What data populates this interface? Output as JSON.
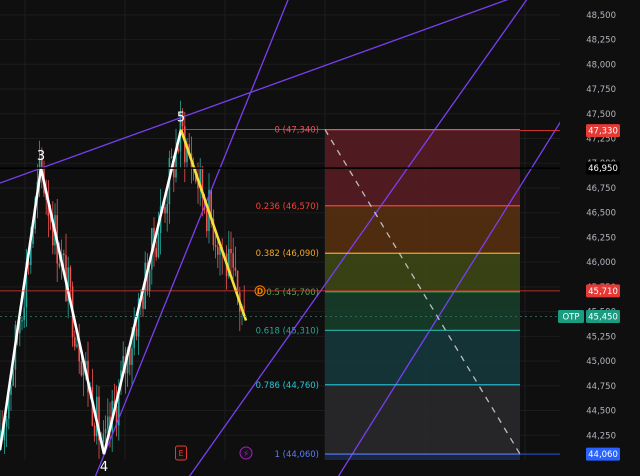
{
  "chart_data": {
    "type": "candlestick",
    "instrument_ticker": "OTP",
    "ylim": [
      44000,
      48650
    ],
    "y_ticks": [
      44250,
      44500,
      44750,
      45000,
      45250,
      45500,
      45750,
      46000,
      46250,
      46500,
      46750,
      47000,
      47250,
      47500,
      47750,
      48000,
      48250,
      48500
    ],
    "y_tick_labels": [
      "44,250",
      "44,500",
      "44,750",
      "45,000",
      "45,250",
      "45,500",
      "45,750",
      "46,000",
      "46,250",
      "46,500",
      "46,750",
      "47,000",
      "47,250",
      "47,500",
      "47,750",
      "48,000",
      "48,250",
      "48,500"
    ],
    "price_tags": [
      {
        "label": "47,330",
        "price": 47330,
        "color": "#e53935",
        "kind": "fib-top"
      },
      {
        "label": "46,950",
        "price": 46950,
        "color": "#000000",
        "kind": "marker"
      },
      {
        "label": "45,710",
        "price": 45710,
        "color": "#e53935",
        "kind": "marker"
      },
      {
        "label": "45,450",
        "price": 45450,
        "color": "#1b9b7f",
        "kind": "last-price"
      },
      {
        "label": "44,060",
        "price": 44060,
        "color": "#2962ff",
        "kind": "fib-bottom"
      }
    ],
    "current_price": 45450,
    "wave_points": [
      {
        "label": "",
        "bar": 0,
        "price": 44100
      },
      {
        "label": "3",
        "bar": 41,
        "price": 46950
      },
      {
        "label": "4",
        "bar": 104,
        "price": 44060
      },
      {
        "label": "5",
        "bar": 181,
        "price": 47340
      }
    ],
    "impulse_leg": {
      "from": {
        "bar": 181,
        "price": 47340
      },
      "to": {
        "bar": 246,
        "price": 45410
      },
      "color": "#f5e13a"
    },
    "fibonacci": {
      "from_bar": 325,
      "to_bar": 520,
      "levels": [
        {
          "ratio": "0",
          "price": 47340,
          "label": "0 (47,340)",
          "color": "#e05660",
          "fill": "#5a1d24"
        },
        {
          "ratio": "0.236",
          "price": 46570,
          "label": "0.236 (46,570)",
          "color": "#f44336",
          "fill": "#5a3010"
        },
        {
          "ratio": "0.382",
          "price": 46090,
          "label": "0.382 (46,090)",
          "color": "#f5a623",
          "fill": "#3e4a14"
        },
        {
          "ratio": "0.5",
          "price": 45700,
          "label": "0.5 (45,700)",
          "color": "#4caf50",
          "fill": "#173f2c"
        },
        {
          "ratio": "0.618",
          "price": 45310,
          "label": "0.618 (45,310)",
          "color": "#26a69a",
          "fill": "#153a3e"
        },
        {
          "ratio": "0.786",
          "price": 44760,
          "label": "0.786 (44,760)",
          "color": "#26c6da",
          "fill": "#2a2a2e"
        },
        {
          "ratio": "1",
          "price": 44060,
          "label": "1 (44,060)",
          "color": "#5c7cfa",
          "fill": "#1b2a4a"
        }
      ],
      "projection": {
        "from": {
          "bar": 325,
          "price": 47340
        },
        "to": {
          "bar": 520,
          "price": 44060
        }
      }
    },
    "trend_lines": [
      {
        "from": {
          "bar": 0,
          "price": 46800
        },
        "to": {
          "bar": 520,
          "price": 48700
        },
        "color": "#7a3ff2"
      },
      {
        "from": {
          "bar": 90,
          "price": 43700
        },
        "to": {
          "bar": 290,
          "price": 48700
        },
        "color": "#7a3ff2"
      },
      {
        "from": {
          "bar": 180,
          "price": 43700
        },
        "to": {
          "bar": 530,
          "price": 48700
        },
        "color": "#7a3ff2"
      },
      {
        "from": {
          "bar": 330,
          "price": 43700
        },
        "to": {
          "bar": 640,
          "price": 48700
        },
        "color": "#7a3ff2"
      }
    ],
    "grid": true,
    "markers": [
      {
        "symbol": "D",
        "bar": 260,
        "price": 45710,
        "color": "#f57c00"
      },
      {
        "symbol": "E",
        "bar": 181,
        "price": null,
        "color": "#e53935"
      },
      {
        "symbol": "⚡",
        "bar": 246,
        "price": null,
        "color": "#9c27b0"
      }
    ],
    "candle_generation": {
      "start_bar": 0,
      "end_bar": 246,
      "bar_spacing": 2.2,
      "up_color": "#26a69a",
      "down_color": "#ef5350"
    }
  }
}
